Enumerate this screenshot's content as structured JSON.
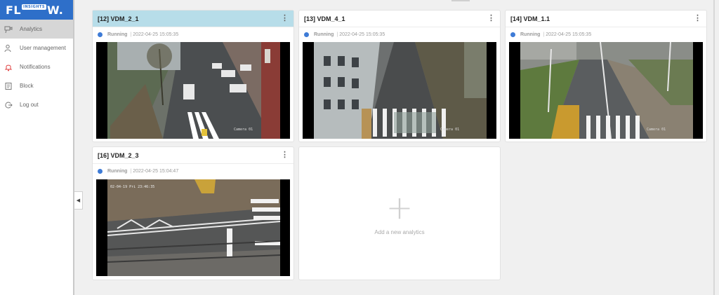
{
  "app": {
    "logo_left": "FL",
    "logo_badge": "INSIGHTS",
    "logo_right": "W."
  },
  "sidebar": {
    "items": [
      {
        "label": "Analytics",
        "icon": "analytics-icon"
      },
      {
        "label": "User management",
        "icon": "users-icon"
      },
      {
        "label": "Notifications",
        "icon": "bell-icon"
      },
      {
        "label": "Block",
        "icon": "block-icon"
      },
      {
        "label": "Log out",
        "icon": "logout-icon"
      }
    ]
  },
  "cards": [
    {
      "title": "[12] VDM_2_1",
      "state": "Running",
      "timestamp": "2022-04-25 15:05:35",
      "overlay": "Camera 01"
    },
    {
      "title": "[13] VDM_4_1",
      "state": "Running",
      "timestamp": "2022-04-25 15:05:35",
      "overlay": "Camera 01"
    },
    {
      "title": "[14] VDM_1.1",
      "state": "Running",
      "timestamp": "2022-04-25 15:05:35",
      "overlay": "Camera 01"
    },
    {
      "title": "[16] VDM_2_3",
      "state": "Running",
      "timestamp": "2022-04-25 15:04:47",
      "overlay": "02-04-19 Pri 23:46:35"
    }
  ],
  "add_card": {
    "label": "Add a new analytics"
  },
  "colors": {
    "accent": "#2e6fc9",
    "selected_header": "#b7dde9",
    "running_dot": "#3e7bd6",
    "notification_icon": "#e04040"
  }
}
